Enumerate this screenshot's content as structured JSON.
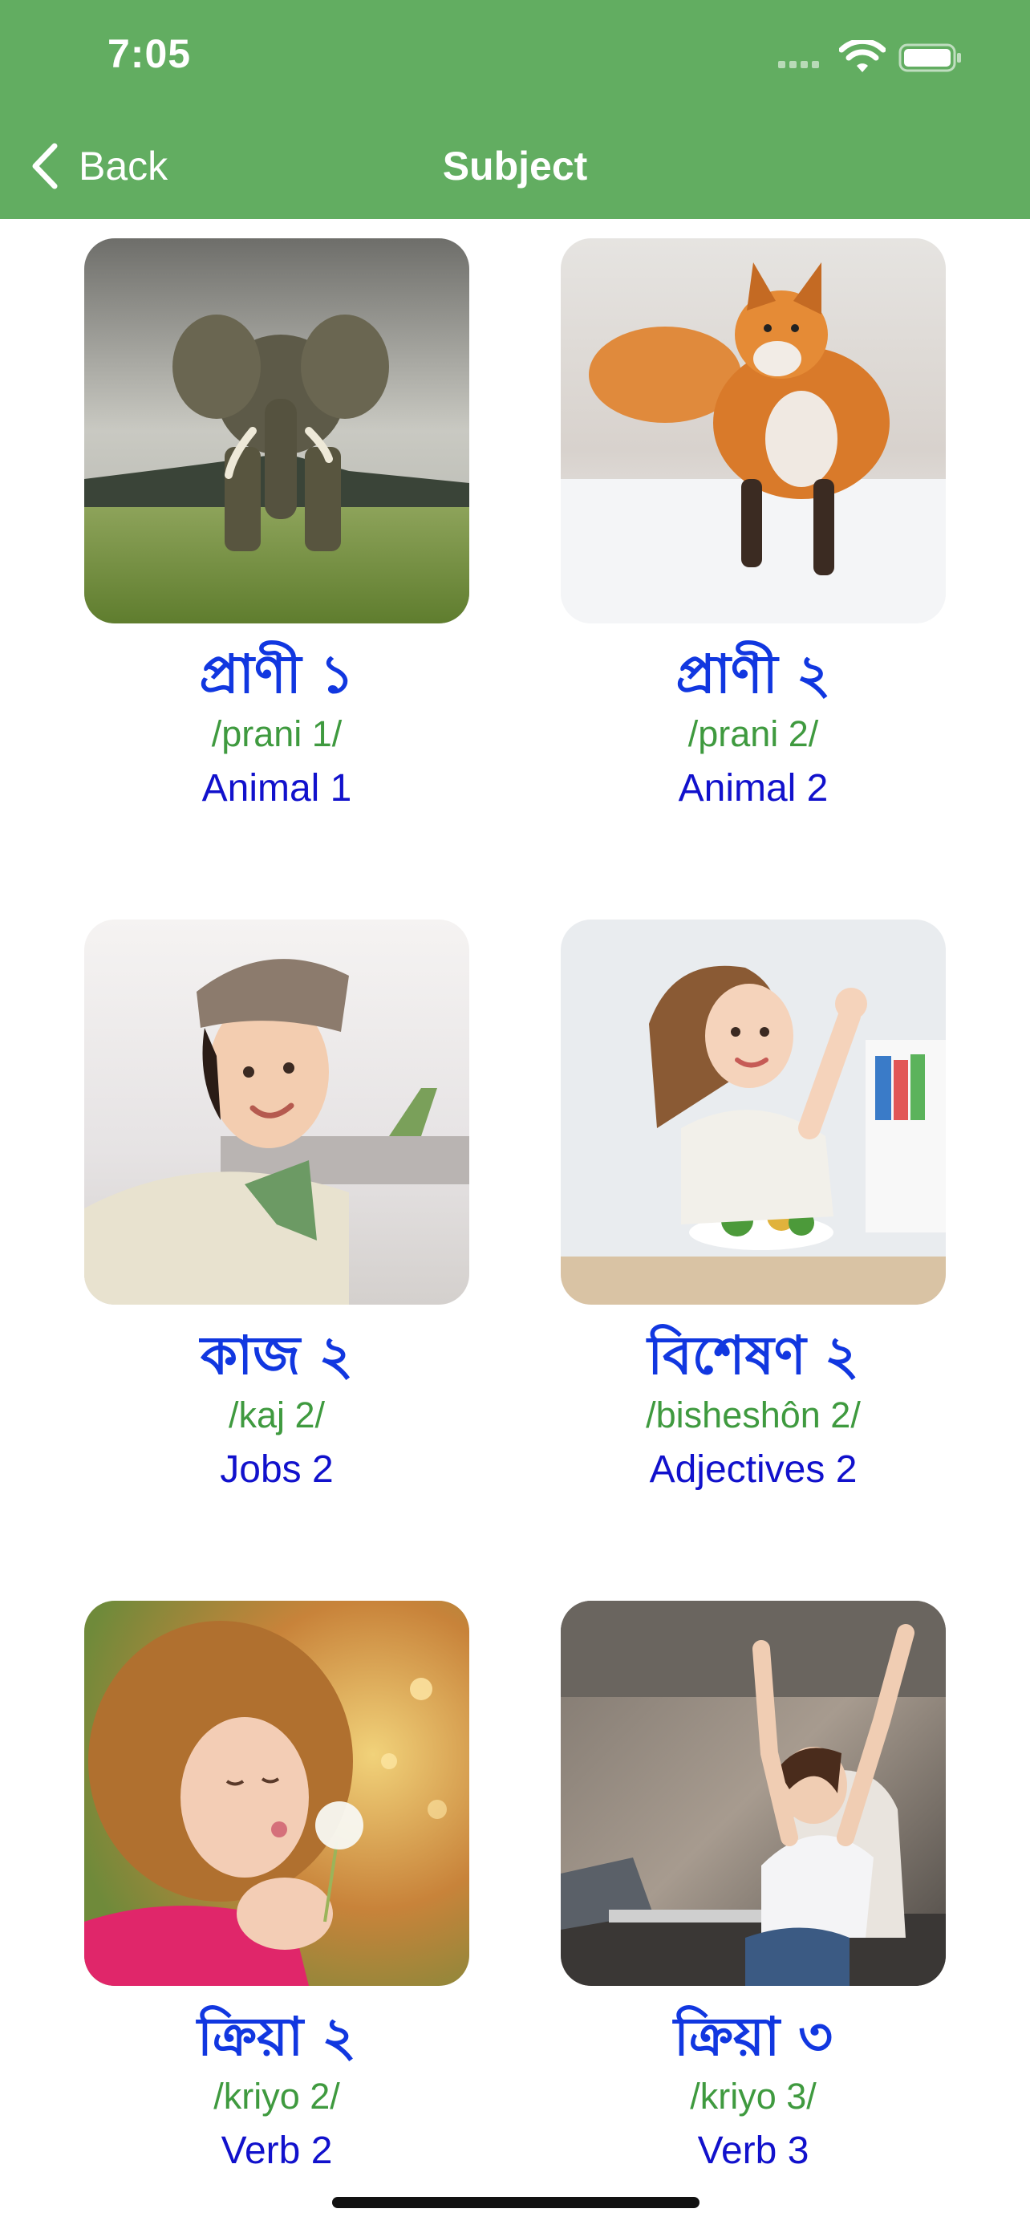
{
  "status_bar": {
    "time": "7:05"
  },
  "nav": {
    "back_label": "Back",
    "title": "Subject"
  },
  "colors": {
    "header": "#62ad61",
    "bengali_text": "#1137e0",
    "transliteration": "#3f9a3f",
    "english": "#1111cc"
  },
  "subjects": [
    {
      "bengali": "প্রাণী ১",
      "transliteration": "/prani 1/",
      "english": "Animal 1",
      "image": "elephant"
    },
    {
      "bengali": "প্রাণী ২",
      "transliteration": "/prani 2/",
      "english": "Animal 2",
      "image": "fox"
    },
    {
      "bengali": "কাজ ২",
      "transliteration": "/kaj 2/",
      "english": "Jobs 2",
      "image": "flight-attendant"
    },
    {
      "bengali": "বিশেষণ ২",
      "transliteration": "/bisheshôn 2/",
      "english": "Adjectives 2",
      "image": "girl-thumbs-up"
    },
    {
      "bengali": "ক্রিয়া ২",
      "transliteration": "/kriyo 2/",
      "english": "Verb 2",
      "image": "girl-blowing-dandelion"
    },
    {
      "bengali": "ক্রিয়া ৩",
      "transliteration": "/kriyo 3/",
      "english": "Verb 3",
      "image": "woman-stretching"
    }
  ]
}
